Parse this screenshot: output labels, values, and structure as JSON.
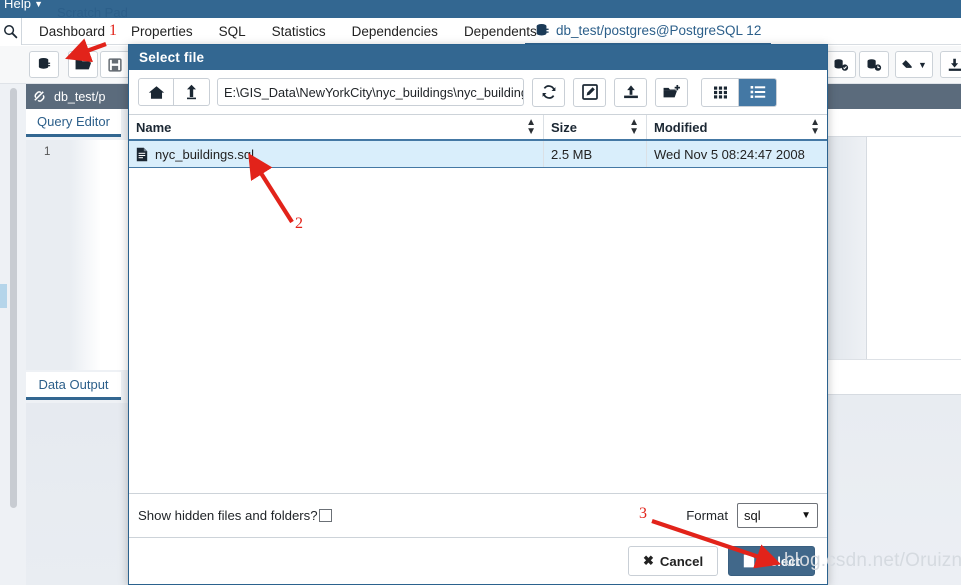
{
  "appbar": {
    "help_menu": "Help"
  },
  "nav": {
    "tabs": [
      {
        "label": "Dashboard"
      },
      {
        "label": "Properties"
      },
      {
        "label": "SQL"
      },
      {
        "label": "Statistics"
      },
      {
        "label": "Dependencies"
      },
      {
        "label": "Dependents"
      }
    ],
    "connection_tab": "db_test/postgres@PostgreSQL 12"
  },
  "query_tool": {
    "conn_label": "db_test/p",
    "editor_tab": "Query Editor",
    "line_number": "1",
    "data_output_tab": "Data Output",
    "scratch_pad_tab": "Scratch Pad"
  },
  "dialog": {
    "title": "Select file",
    "path_value": "E:\\GIS_Data\\NewYorkCity\\nyc_buildings\\nyc_buildings....",
    "columns": [
      {
        "label": "Name"
      },
      {
        "label": "Size"
      },
      {
        "label": "Modified"
      }
    ],
    "rows": [
      {
        "name": "nyc_buildings.sql",
        "size": "2.5 MB",
        "modified": "Wed Nov 5 08:24:47 2008"
      }
    ],
    "show_hidden_label": "Show hidden files and folders?",
    "format_label": "Format",
    "format_value": "sql",
    "cancel_label": "Cancel",
    "select_label": "Select"
  },
  "annotations": {
    "marker1": "1",
    "marker2": "2",
    "marker3": "3"
  },
  "watermark": "blog.csdn.net/Oruizn",
  "colors": {
    "brand_blue": "#336791",
    "dialog_header": "#336791",
    "row_selected": "#d9eefb",
    "annotation_red": "#e2231a",
    "select_button": "#41688a"
  }
}
